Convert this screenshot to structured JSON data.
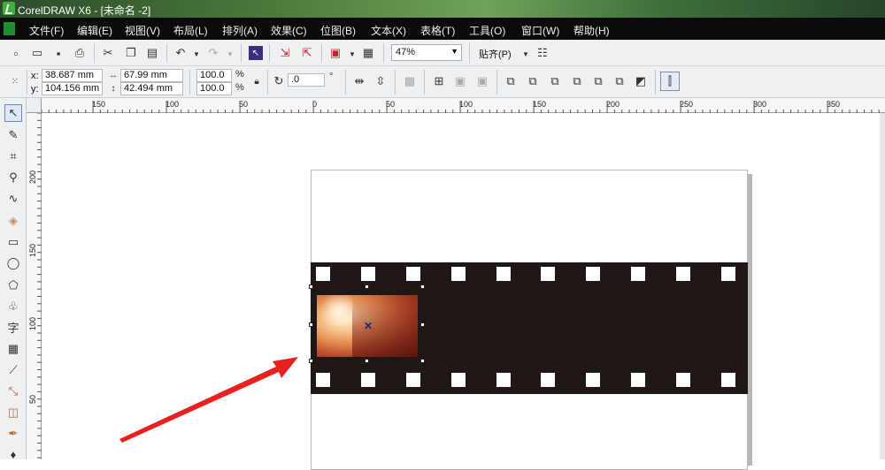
{
  "window": {
    "title": "CorelDRAW X6 - [未命名 -2]"
  },
  "menu": [
    {
      "label": "文件(F)"
    },
    {
      "label": "编辑(E)"
    },
    {
      "label": "视图(V)"
    },
    {
      "label": "布局(L)"
    },
    {
      "label": "排列(A)"
    },
    {
      "label": "效果(C)"
    },
    {
      "label": "位图(B)"
    },
    {
      "label": "文本(X)"
    },
    {
      "label": "表格(T)"
    },
    {
      "label": "工具(O)"
    },
    {
      "label": "窗口(W)"
    },
    {
      "label": "帮助(H)"
    }
  ],
  "standard_toolbar": {
    "zoom": "47%",
    "snap_label": "贴齐(P)"
  },
  "property_bar": {
    "x_label": "x:",
    "x_value": "38.687 mm",
    "y_label": "y:",
    "y_value": "104.156 mm",
    "width_value": "67.99 mm",
    "height_value": "42.494 mm",
    "scale_x": "100.0",
    "scale_y": "100.0",
    "percent": "%",
    "rotation": ".0",
    "degree": "°"
  },
  "ruler_h_labels": [
    "150",
    "100",
    "50",
    "0",
    "50",
    "100",
    "150",
    "200",
    "250",
    "300",
    "350"
  ],
  "ruler_v_labels": [
    "200",
    "150",
    "100",
    "50"
  ],
  "colors": {
    "film": "#1f1715",
    "arrow": "#e8201f",
    "menubar": "#0b0b0b"
  }
}
